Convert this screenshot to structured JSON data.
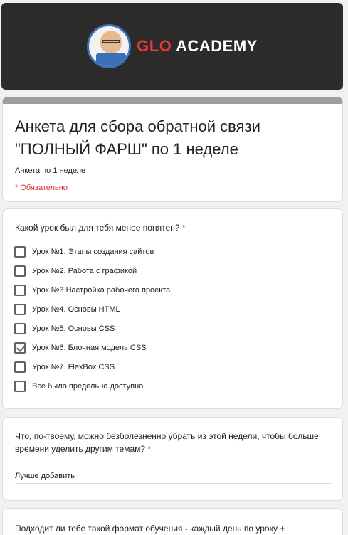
{
  "header": {
    "logo_glo": "GLO",
    "logo_academy": "ACADEMY"
  },
  "form": {
    "title": "Анкета для сбора обратной связи \"ПОЛНЫЙ ФАРШ\" по 1 неделе",
    "description": "Анкета по 1 неделе",
    "required_note": "* Обязательно"
  },
  "q1": {
    "title": "Какой урок был для тебя менее понятен?",
    "required_mark": "*",
    "options": [
      {
        "label": "Урок №1. Этапы создания сайтов",
        "checked": false
      },
      {
        "label": "Урок №2. Работа с графикой",
        "checked": false
      },
      {
        "label": "Урок №3 Настройка рабочего проекта",
        "checked": false
      },
      {
        "label": "Урок №4. Основы HTML",
        "checked": false
      },
      {
        "label": "Урок №5. Основы CSS",
        "checked": false
      },
      {
        "label": "Урок №6. Блочная модель CSS",
        "checked": true
      },
      {
        "label": "Урок №7. FlexBox CSS",
        "checked": false
      },
      {
        "label": "Все было предельно доступно",
        "checked": false
      }
    ]
  },
  "q2": {
    "title": "Что, по-твоему, можно безболезненно убрать из этой недели, чтобы больше времени уделить другим темам?",
    "required_mark": "*",
    "answer": "Лучше добавить"
  },
  "q3": {
    "title": "Подходит ли тебе такой формат обучения - каждый день по уроку +"
  },
  "colors": {
    "required": "#d93025",
    "header_bg": "#2b2b2b",
    "accent_red": "#e53935",
    "page_bg": "#f1f1f1"
  }
}
